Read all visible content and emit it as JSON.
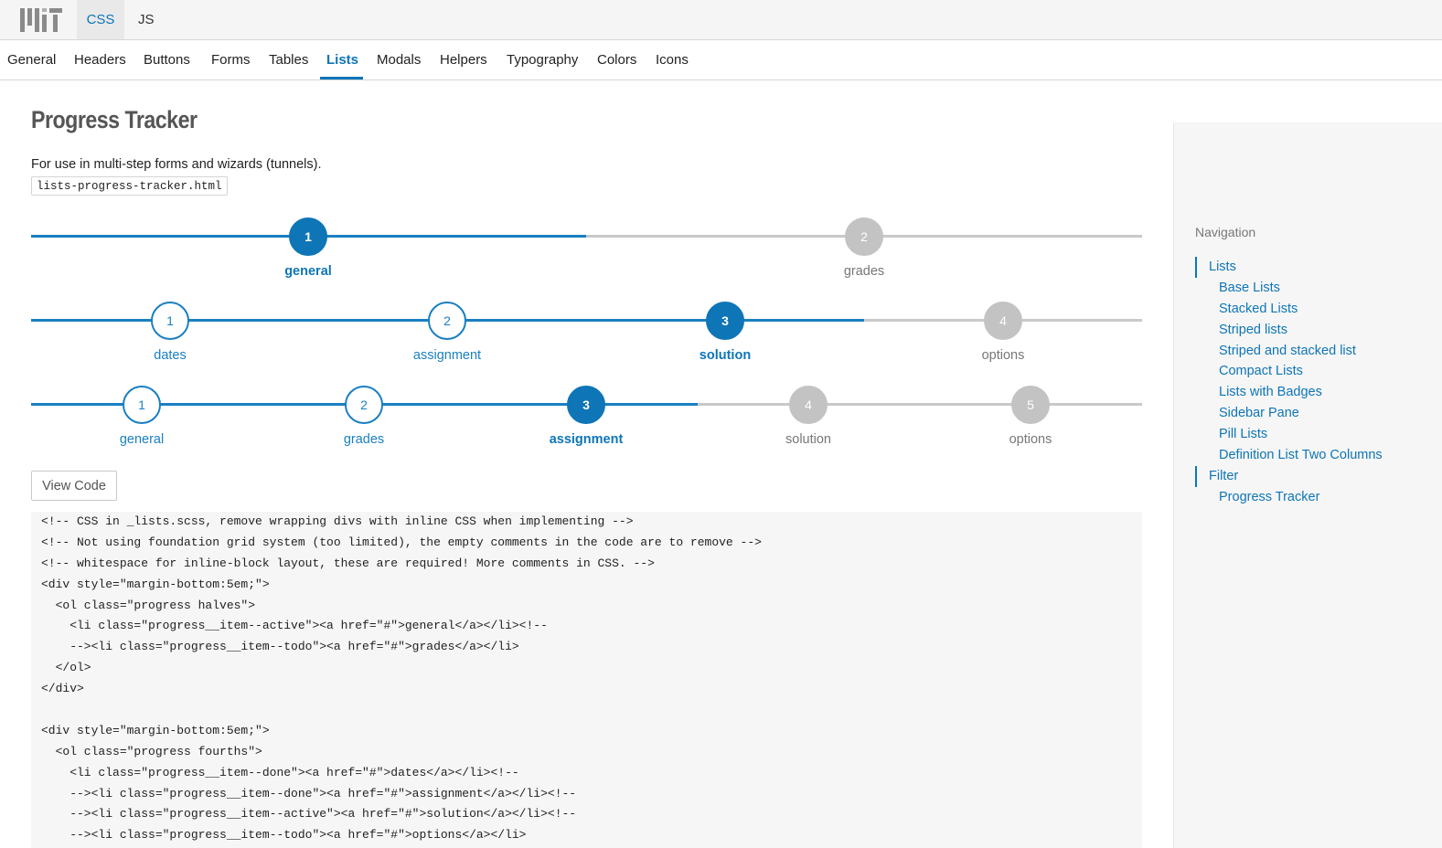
{
  "header": {
    "logo_name": "mit-logo",
    "tabs": [
      {
        "label": "CSS",
        "active": true
      },
      {
        "label": "JS",
        "active": false
      }
    ]
  },
  "subnav": {
    "items": [
      "General",
      "Headers",
      "Buttons",
      "Forms",
      "Tables",
      "Lists",
      "Modals",
      "Helpers",
      "Typography",
      "Colors",
      "Icons"
    ],
    "active": "Lists"
  },
  "main": {
    "title": "Progress Tracker",
    "description": "For use in multi-step forms and wizards (tunnels).",
    "file_name": "lists-progress-tracker.html",
    "view_code_label": "View Code"
  },
  "trackers": [
    {
      "steps": [
        {
          "number": "1",
          "label": "general",
          "state": "active"
        },
        {
          "number": "2",
          "label": "grades",
          "state": "todo"
        }
      ]
    },
    {
      "steps": [
        {
          "number": "1",
          "label": "dates",
          "state": "done"
        },
        {
          "number": "2",
          "label": "assignment",
          "state": "done"
        },
        {
          "number": "3",
          "label": "solution",
          "state": "active"
        },
        {
          "number": "4",
          "label": "options",
          "state": "todo"
        }
      ]
    },
    {
      "steps": [
        {
          "number": "1",
          "label": "general",
          "state": "done"
        },
        {
          "number": "2",
          "label": "grades",
          "state": "done"
        },
        {
          "number": "3",
          "label": "assignment",
          "state": "active"
        },
        {
          "number": "4",
          "label": "solution",
          "state": "todo"
        },
        {
          "number": "5",
          "label": "options",
          "state": "todo"
        }
      ]
    }
  ],
  "code_lines": [
    "<!-- CSS in _lists.scss, remove wrapping divs with inline CSS when implementing -->",
    "<!-- Not using foundation grid system (too limited), the empty comments in the code are to remove -->",
    "<!-- whitespace for inline-block layout, these are required! More comments in CSS. -->",
    "<div style=\"margin-bottom:5em;\">",
    "  <ol class=\"progress halves\">",
    "    <li class=\"progress__item--active\"><a href=\"#\">general</a></li><!--",
    "    --><li class=\"progress__item--todo\"><a href=\"#\">grades</a></li>",
    "  </ol>",
    "</div>",
    "",
    "<div style=\"margin-bottom:5em;\">",
    "  <ol class=\"progress fourths\">",
    "    <li class=\"progress__item--done\"><a href=\"#\">dates</a></li><!--",
    "    --><li class=\"progress__item--done\"><a href=\"#\">assignment</a></li><!--",
    "    --><li class=\"progress__item--active\"><a href=\"#\">solution</a></li><!--",
    "    --><li class=\"progress__item--todo\"><a href=\"#\">options</a></li>"
  ],
  "sidebar": {
    "heading": "Navigation",
    "items": [
      {
        "label": "Lists",
        "level": "top"
      },
      {
        "label": "Base Lists",
        "level": "sub"
      },
      {
        "label": "Stacked Lists",
        "level": "sub"
      },
      {
        "label": "Striped lists",
        "level": "sub"
      },
      {
        "label": "Striped and stacked list",
        "level": "sub"
      },
      {
        "label": "Compact Lists",
        "level": "sub"
      },
      {
        "label": "Lists with Badges",
        "level": "sub"
      },
      {
        "label": "Sidebar Pane",
        "level": "sub"
      },
      {
        "label": "Pill Lists",
        "level": "sub"
      },
      {
        "label": "Definition List Two Columns",
        "level": "sub"
      },
      {
        "label": "Filter",
        "level": "top"
      },
      {
        "label": "Progress Tracker",
        "level": "sub"
      }
    ]
  },
  "colors": {
    "accent": "#0e75b7",
    "done": "#1a7fc2",
    "todo": "#c3c3c3",
    "code_bg": "#f6f6f6"
  }
}
